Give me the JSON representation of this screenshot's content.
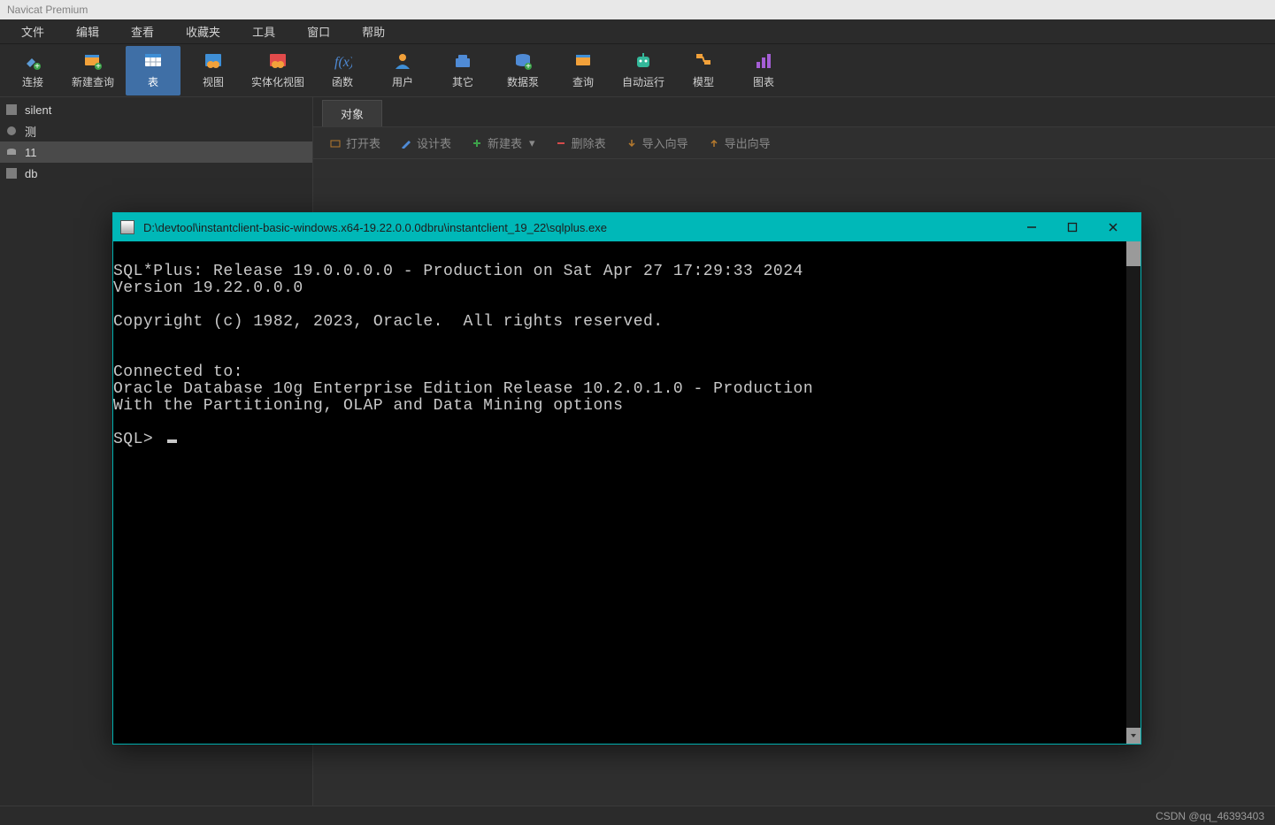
{
  "app": {
    "title": "Navicat Premium"
  },
  "menu": {
    "items": [
      "文件",
      "编辑",
      "查看",
      "收藏夹",
      "工具",
      "窗口",
      "帮助"
    ]
  },
  "ribbon": {
    "items": [
      {
        "id": "connect",
        "label": "连接"
      },
      {
        "id": "newquery",
        "label": "新建查询"
      },
      {
        "id": "table",
        "label": "表"
      },
      {
        "id": "view",
        "label": "视图"
      },
      {
        "id": "matview",
        "label": "实体化视图"
      },
      {
        "id": "function",
        "label": "函数"
      },
      {
        "id": "user",
        "label": "用户"
      },
      {
        "id": "other",
        "label": "其它"
      },
      {
        "id": "datapump",
        "label": "数据泵"
      },
      {
        "id": "query",
        "label": "查询"
      },
      {
        "id": "autorun",
        "label": "自动运行"
      },
      {
        "id": "model",
        "label": "模型"
      },
      {
        "id": "chart",
        "label": "图表"
      }
    ],
    "active": "table"
  },
  "sidebar": {
    "items": [
      {
        "id": "silent",
        "label": "silent"
      },
      {
        "id": "ce",
        "label": "测"
      },
      {
        "id": "eleven",
        "label": "11"
      },
      {
        "id": "db",
        "label": "db"
      }
    ],
    "selected": "eleven"
  },
  "main": {
    "tab": {
      "label": "对象"
    },
    "toolbar": {
      "open": "打开表",
      "design": "设计表",
      "new": "新建表",
      "delete": "删除表",
      "import": "导入向导",
      "export": "导出向导"
    }
  },
  "terminal": {
    "title": "D:\\devtool\\instantclient-basic-windows.x64-19.22.0.0.0dbru\\instantclient_19_22\\sqlplus.exe",
    "lines": [
      "SQL*Plus: Release 19.0.0.0.0 - Production on Sat Apr 27 17:29:33 2024",
      "Version 19.22.0.0.0",
      "",
      "Copyright (c) 1982, 2023, Oracle.  All rights reserved.",
      "",
      "",
      "Connected to:",
      "Oracle Database 10g Enterprise Edition Release 10.2.0.1.0 - Production",
      "With the Partitioning, OLAP and Data Mining options",
      "",
      "SQL> "
    ]
  },
  "footer": {
    "watermark": "CSDN @qq_46393403"
  }
}
